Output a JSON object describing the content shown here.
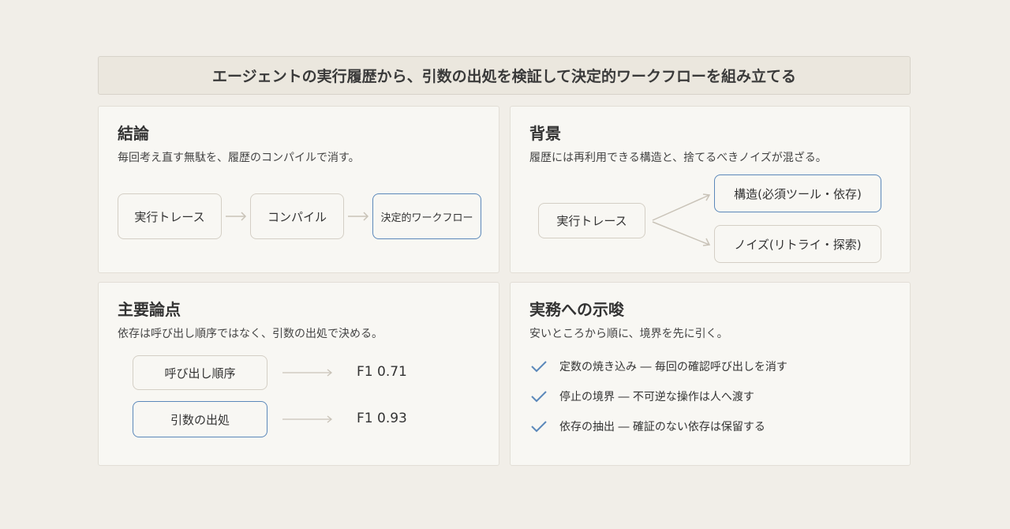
{
  "title": "エージェントの実行履歴から、引数の出処を検証して決定的ワークフローを組み立てる",
  "conclusion": {
    "heading": "結論",
    "subtitle": "毎回考え直す無駄を、履歴のコンパイルで消す。",
    "flow": [
      "実行トレース",
      "コンパイル",
      "決定的ワークフロー"
    ]
  },
  "background": {
    "heading": "背景",
    "subtitle": "履歴には再利用できる構造と、捨てるべきノイズが混ざる。",
    "source": "実行トレース",
    "branches": [
      "構造(必須ツール・依存)",
      "ノイズ(リトライ・探索)"
    ]
  },
  "points": {
    "heading": "主要論点",
    "subtitle": "依存は呼び出し順序ではなく、引数の出処で決める。",
    "rows": [
      {
        "label": "呼び出し順序",
        "score": "F1 0.71"
      },
      {
        "label": "引数の出処",
        "score": "F1 0.93"
      }
    ]
  },
  "implications": {
    "heading": "実務への示唆",
    "subtitle": "安いところから順に、境界を先に引く。",
    "items": [
      "定数の焼き込み ― 毎回の確認呼び出しを消す",
      "停止の境界 ― 不可逆な操作は人へ渡す",
      "依存の抽出 ― 確証のない依存は保留する"
    ]
  },
  "colors": {
    "accent": "#5b88ba",
    "border": "#d4cfc5",
    "background": "#f1eee8",
    "card": "#f8f7f3",
    "arrow": "#c9c3b8"
  }
}
